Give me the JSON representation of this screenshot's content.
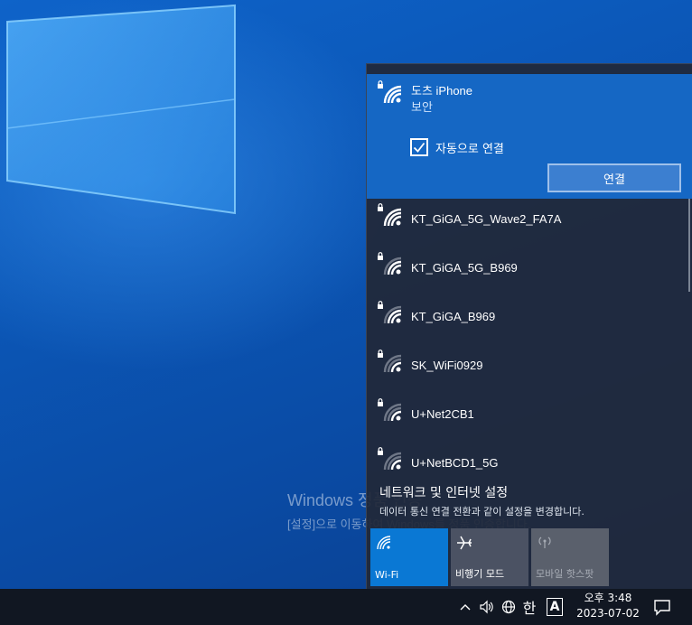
{
  "desktop": {
    "watermark": {
      "line1": "Windows 정품 인증",
      "line2": "[설정]으로 이동하여 Windows를 정품 인증합니다."
    }
  },
  "network_flyout": {
    "selected_network": {
      "name": "도츠 iPhone",
      "security": "보안",
      "auto_connect_label": "자동으로 연결",
      "auto_connect_checked": true,
      "connect_button_label": "연결"
    },
    "networks": [
      {
        "name": "KT_GiGA_5G_Wave2_FA7A",
        "signal": "full",
        "secured": true
      },
      {
        "name": "KT_GiGA_5G_B969",
        "signal": "medium",
        "secured": true
      },
      {
        "name": "KT_GiGA_B969",
        "signal": "medium",
        "secured": true
      },
      {
        "name": "SK_WiFi0929",
        "signal": "low",
        "secured": true
      },
      {
        "name": "U+Net2CB1",
        "signal": "low",
        "secured": true
      },
      {
        "name": "U+NetBCD1_5G",
        "signal": "low",
        "secured": true
      }
    ],
    "settings_link": "네트워크 및 인터넷 설정",
    "settings_description": "데이터 통신 연결 전환과 같이 설정을 변경합니다.",
    "quick_actions": [
      {
        "label": "Wi-Fi",
        "icon": "wifi-icon",
        "state": "on"
      },
      {
        "label": "비행기 모드",
        "icon": "airplane-icon",
        "state": "off"
      },
      {
        "label": "모바일 핫스팟",
        "icon": "hotspot-icon",
        "state": "disabled"
      }
    ]
  },
  "taskbar": {
    "tray": {
      "input_mode_label": "A",
      "ime_label": "한",
      "time": "오후 3:48",
      "date": "2023-07-02"
    }
  },
  "colors": {
    "accent": "#0078d7",
    "selected_network_bg": "#1567c4",
    "flyout_bg": "#212838",
    "taskbar_bg": "#111722"
  }
}
